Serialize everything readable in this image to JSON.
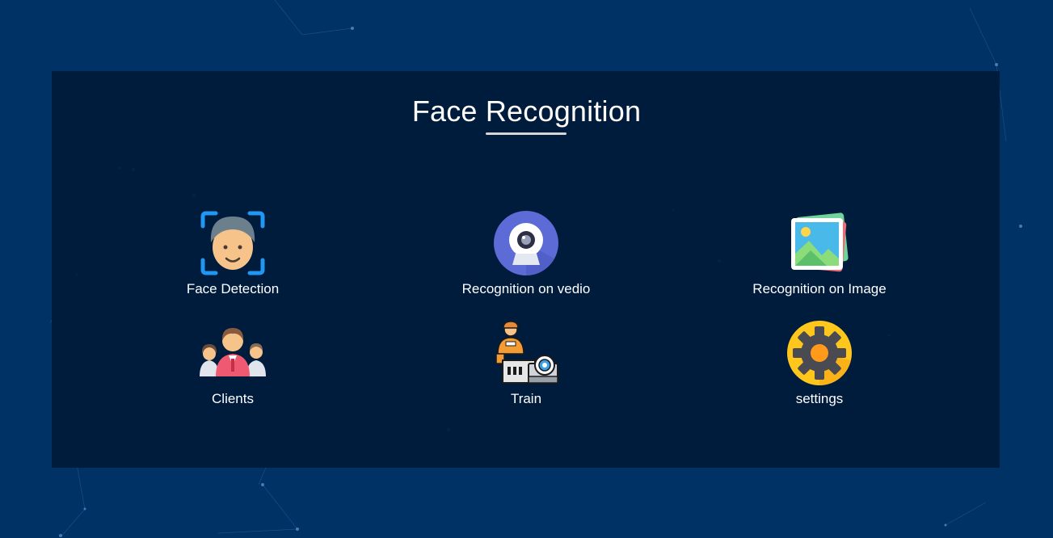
{
  "page": {
    "title": "Face Recognition"
  },
  "menu": {
    "items": [
      {
        "label": "Face Detection",
        "icon": "face-scan-icon"
      },
      {
        "label": "Recognition on vedio",
        "icon": "webcam-icon"
      },
      {
        "label": "Recognition on Image",
        "icon": "image-gallery-icon"
      },
      {
        "label": "Clients",
        "icon": "people-group-icon"
      },
      {
        "label": "Train",
        "icon": "worker-machine-icon"
      },
      {
        "label": "settings",
        "icon": "gear-icon"
      }
    ]
  },
  "colors": {
    "background": "#013266",
    "panel": "#001a3a",
    "text": "#ffffff",
    "underline": "#d6d6d6"
  }
}
